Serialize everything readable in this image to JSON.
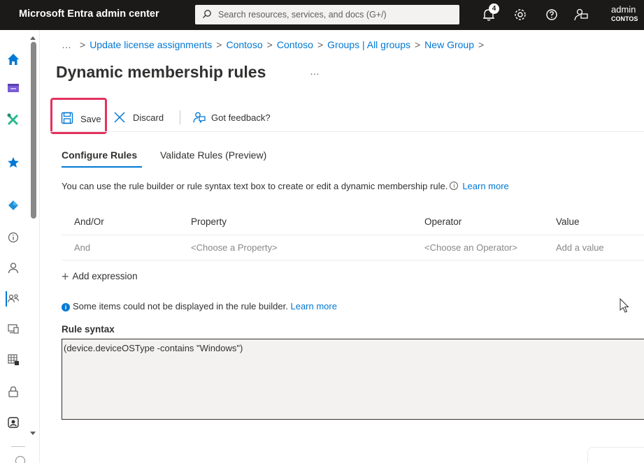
{
  "header": {
    "app_title": "Microsoft Entra admin center",
    "search_placeholder": "Search resources, services, and docs (G+/)",
    "notification_count": "4",
    "user_name": "admin",
    "user_org": "CONTOS"
  },
  "rail": {
    "icons": [
      "home-icon",
      "dashboard-icon",
      "tools-icon",
      "favorites-star-icon",
      "identity-diamond-icon",
      "info-icon",
      "user-icon",
      "groups-icon",
      "devices-icon",
      "apps-icon",
      "lock-icon",
      "protection-icon"
    ]
  },
  "breadcrumb": {
    "ellipsis": "…",
    "items": [
      "Update license assignments",
      "Contoso",
      "Contoso",
      "Groups | All groups",
      "New Group"
    ],
    "separator": ">"
  },
  "page": {
    "title": "Dynamic membership rules",
    "more": "…"
  },
  "toolbar": {
    "save_label": "Save",
    "discard_label": "Discard",
    "feedback_label": "Got feedback?"
  },
  "tabs": [
    {
      "label": "Configure Rules",
      "active": true
    },
    {
      "label": "Validate Rules (Preview)",
      "active": false
    }
  ],
  "description": {
    "text": "You can use the rule builder or rule syntax text box to create or edit a dynamic membership rule.",
    "info_glyph": "i",
    "link": "Learn more"
  },
  "rules_table": {
    "headers": [
      "And/Or",
      "Property",
      "Operator",
      "Value"
    ],
    "rows": [
      [
        "And",
        "<Choose a Property>",
        "<Choose an Operator>",
        "Add a value"
      ]
    ]
  },
  "add_expression": {
    "plus": "+",
    "label": "Add expression"
  },
  "notice": {
    "glyph": "i",
    "text": "Some items could not be displayed in the rule builder.",
    "link": "Learn more"
  },
  "rule_syntax": {
    "label": "Rule syntax",
    "value": "(device.deviceOSType -contains \"Windows\")"
  },
  "colors": {
    "topbar": "#1b1a19",
    "accent": "#0078d4",
    "highlight": "#e3325f"
  }
}
